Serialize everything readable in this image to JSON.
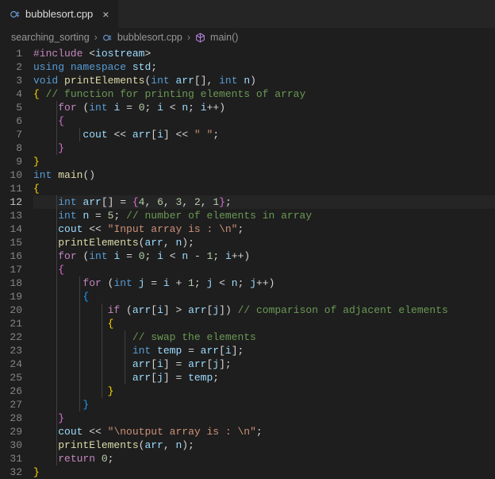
{
  "tab": {
    "filename": "bubblesort.cpp"
  },
  "breadcrumb": {
    "folder": "searching_sorting",
    "file": "bubblesort.cpp",
    "symbol": "main()"
  },
  "editor": {
    "current_line": 12,
    "lines": [
      {
        "n": 1,
        "tokens": [
          [
            "pp",
            "#include"
          ],
          [
            "op",
            " "
          ],
          [
            "punc",
            "<"
          ],
          [
            "id",
            "iostream"
          ],
          [
            "punc",
            ">"
          ]
        ]
      },
      {
        "n": 2,
        "tokens": [
          [
            "kw",
            "using"
          ],
          [
            "op",
            " "
          ],
          [
            "kw",
            "namespace"
          ],
          [
            "op",
            " "
          ],
          [
            "id",
            "std"
          ],
          [
            "punc",
            ";"
          ]
        ]
      },
      {
        "n": 3,
        "tokens": [
          [
            "kw",
            "void"
          ],
          [
            "op",
            " "
          ],
          [
            "func",
            "printElements"
          ],
          [
            "punc",
            "("
          ],
          [
            "kw",
            "int"
          ],
          [
            "op",
            " "
          ],
          [
            "id",
            "arr"
          ],
          [
            "punc",
            "[]"
          ],
          [
            "punc",
            ","
          ],
          [
            "op",
            " "
          ],
          [
            "kw",
            "int"
          ],
          [
            "op",
            " "
          ],
          [
            "id",
            "n"
          ],
          [
            "punc",
            ")"
          ]
        ]
      },
      {
        "n": 4,
        "tokens": [
          [
            "brak",
            "{"
          ],
          [
            "op",
            " "
          ],
          [
            "cmt",
            "// function for printing elements of array"
          ]
        ]
      },
      {
        "n": 5,
        "indent": 1,
        "tokens": [
          [
            "pp",
            "for"
          ],
          [
            "op",
            " "
          ],
          [
            "punc",
            "("
          ],
          [
            "kw",
            "int"
          ],
          [
            "op",
            " "
          ],
          [
            "id",
            "i"
          ],
          [
            "op",
            " = "
          ],
          [
            "num",
            "0"
          ],
          [
            "punc",
            ";"
          ],
          [
            "op",
            " "
          ],
          [
            "id",
            "i"
          ],
          [
            "op",
            " < "
          ],
          [
            "id",
            "n"
          ],
          [
            "punc",
            ";"
          ],
          [
            "op",
            " "
          ],
          [
            "id",
            "i"
          ],
          [
            "op",
            "++"
          ],
          [
            "punc",
            ")"
          ]
        ]
      },
      {
        "n": 6,
        "indent": 1,
        "tokens": [
          [
            "brak2",
            "{"
          ]
        ]
      },
      {
        "n": 7,
        "indent": 2,
        "tokens": [
          [
            "id",
            "cout"
          ],
          [
            "op",
            " << "
          ],
          [
            "id",
            "arr"
          ],
          [
            "punc",
            "["
          ],
          [
            "id",
            "i"
          ],
          [
            "punc",
            "]"
          ],
          [
            "op",
            " << "
          ],
          [
            "str",
            "\" \""
          ],
          [
            "punc",
            ";"
          ]
        ]
      },
      {
        "n": 8,
        "indent": 1,
        "tokens": [
          [
            "brak2",
            "}"
          ]
        ]
      },
      {
        "n": 9,
        "tokens": [
          [
            "brak",
            "}"
          ]
        ]
      },
      {
        "n": 10,
        "tokens": [
          [
            "kw",
            "int"
          ],
          [
            "op",
            " "
          ],
          [
            "func",
            "main"
          ],
          [
            "punc",
            "()"
          ]
        ]
      },
      {
        "n": 11,
        "tokens": [
          [
            "brak",
            "{"
          ]
        ]
      },
      {
        "n": 12,
        "indent": 1,
        "tokens": [
          [
            "kw",
            "int"
          ],
          [
            "op",
            " "
          ],
          [
            "id",
            "arr"
          ],
          [
            "punc",
            "[]"
          ],
          [
            "op",
            " = "
          ],
          [
            "brak2",
            "{"
          ],
          [
            "num",
            "4"
          ],
          [
            "punc",
            ", "
          ],
          [
            "num",
            "6"
          ],
          [
            "punc",
            ", "
          ],
          [
            "num",
            "3"
          ],
          [
            "punc",
            ", "
          ],
          [
            "num",
            "2"
          ],
          [
            "punc",
            ", "
          ],
          [
            "num",
            "1"
          ],
          [
            "brak2",
            "}"
          ],
          [
            "punc",
            ";"
          ]
        ]
      },
      {
        "n": 13,
        "indent": 1,
        "tokens": [
          [
            "kw",
            "int"
          ],
          [
            "op",
            " "
          ],
          [
            "id",
            "n"
          ],
          [
            "op",
            " = "
          ],
          [
            "num",
            "5"
          ],
          [
            "punc",
            ";"
          ],
          [
            "op",
            " "
          ],
          [
            "cmt",
            "// number of elements in array"
          ]
        ]
      },
      {
        "n": 14,
        "indent": 1,
        "tokens": [
          [
            "id",
            "cout"
          ],
          [
            "op",
            " << "
          ],
          [
            "str",
            "\"Input array is : \\n\""
          ],
          [
            "punc",
            ";"
          ]
        ]
      },
      {
        "n": 15,
        "indent": 1,
        "tokens": [
          [
            "func",
            "printElements"
          ],
          [
            "punc",
            "("
          ],
          [
            "id",
            "arr"
          ],
          [
            "punc",
            ", "
          ],
          [
            "id",
            "n"
          ],
          [
            "punc",
            ")"
          ],
          [
            "punc",
            ";"
          ]
        ]
      },
      {
        "n": 16,
        "indent": 1,
        "tokens": [
          [
            "pp",
            "for"
          ],
          [
            "op",
            " "
          ],
          [
            "punc",
            "("
          ],
          [
            "kw",
            "int"
          ],
          [
            "op",
            " "
          ],
          [
            "id",
            "i"
          ],
          [
            "op",
            " = "
          ],
          [
            "num",
            "0"
          ],
          [
            "punc",
            ";"
          ],
          [
            "op",
            " "
          ],
          [
            "id",
            "i"
          ],
          [
            "op",
            " < "
          ],
          [
            "id",
            "n"
          ],
          [
            "op",
            " - "
          ],
          [
            "num",
            "1"
          ],
          [
            "punc",
            ";"
          ],
          [
            "op",
            " "
          ],
          [
            "id",
            "i"
          ],
          [
            "op",
            "++"
          ],
          [
            "punc",
            ")"
          ]
        ]
      },
      {
        "n": 17,
        "indent": 1,
        "tokens": [
          [
            "brak2",
            "{"
          ]
        ]
      },
      {
        "n": 18,
        "indent": 2,
        "tokens": [
          [
            "pp",
            "for"
          ],
          [
            "op",
            " "
          ],
          [
            "punc",
            "("
          ],
          [
            "kw",
            "int"
          ],
          [
            "op",
            " "
          ],
          [
            "id",
            "j"
          ],
          [
            "op",
            " = "
          ],
          [
            "id",
            "i"
          ],
          [
            "op",
            " + "
          ],
          [
            "num",
            "1"
          ],
          [
            "punc",
            ";"
          ],
          [
            "op",
            " "
          ],
          [
            "id",
            "j"
          ],
          [
            "op",
            " < "
          ],
          [
            "id",
            "n"
          ],
          [
            "punc",
            ";"
          ],
          [
            "op",
            " "
          ],
          [
            "id",
            "j"
          ],
          [
            "op",
            "++"
          ],
          [
            "punc",
            ")"
          ]
        ]
      },
      {
        "n": 19,
        "indent": 2,
        "tokens": [
          [
            "brak3",
            "{"
          ]
        ]
      },
      {
        "n": 20,
        "indent": 3,
        "tokens": [
          [
            "pp",
            "if"
          ],
          [
            "op",
            " "
          ],
          [
            "punc",
            "("
          ],
          [
            "id",
            "arr"
          ],
          [
            "punc",
            "["
          ],
          [
            "id",
            "i"
          ],
          [
            "punc",
            "]"
          ],
          [
            "op",
            " > "
          ],
          [
            "id",
            "arr"
          ],
          [
            "punc",
            "["
          ],
          [
            "id",
            "j"
          ],
          [
            "punc",
            "]"
          ],
          [
            "punc",
            ")"
          ],
          [
            "op",
            " "
          ],
          [
            "cmt",
            "// comparison of adjacent elements"
          ]
        ]
      },
      {
        "n": 21,
        "indent": 3,
        "tokens": [
          [
            "brak",
            "{"
          ]
        ]
      },
      {
        "n": 22,
        "indent": 4,
        "tokens": [
          [
            "cmt",
            "// swap the elements"
          ]
        ]
      },
      {
        "n": 23,
        "indent": 4,
        "tokens": [
          [
            "kw",
            "int"
          ],
          [
            "op",
            " "
          ],
          [
            "id",
            "temp"
          ],
          [
            "op",
            " = "
          ],
          [
            "id",
            "arr"
          ],
          [
            "punc",
            "["
          ],
          [
            "id",
            "i"
          ],
          [
            "punc",
            "]"
          ],
          [
            "punc",
            ";"
          ]
        ]
      },
      {
        "n": 24,
        "indent": 4,
        "tokens": [
          [
            "id",
            "arr"
          ],
          [
            "punc",
            "["
          ],
          [
            "id",
            "i"
          ],
          [
            "punc",
            "]"
          ],
          [
            "op",
            " = "
          ],
          [
            "id",
            "arr"
          ],
          [
            "punc",
            "["
          ],
          [
            "id",
            "j"
          ],
          [
            "punc",
            "]"
          ],
          [
            "punc",
            ";"
          ]
        ]
      },
      {
        "n": 25,
        "indent": 4,
        "tokens": [
          [
            "id",
            "arr"
          ],
          [
            "punc",
            "["
          ],
          [
            "id",
            "j"
          ],
          [
            "punc",
            "]"
          ],
          [
            "op",
            " = "
          ],
          [
            "id",
            "temp"
          ],
          [
            "punc",
            ";"
          ]
        ]
      },
      {
        "n": 26,
        "indent": 3,
        "tokens": [
          [
            "brak",
            "}"
          ]
        ]
      },
      {
        "n": 27,
        "indent": 2,
        "tokens": [
          [
            "brak3",
            "}"
          ]
        ]
      },
      {
        "n": 28,
        "indent": 1,
        "tokens": [
          [
            "brak2",
            "}"
          ]
        ]
      },
      {
        "n": 29,
        "indent": 1,
        "tokens": [
          [
            "id",
            "cout"
          ],
          [
            "op",
            " << "
          ],
          [
            "str",
            "\"\\noutput array is : \\n\""
          ],
          [
            "punc",
            ";"
          ]
        ]
      },
      {
        "n": 30,
        "indent": 1,
        "tokens": [
          [
            "func",
            "printElements"
          ],
          [
            "punc",
            "("
          ],
          [
            "id",
            "arr"
          ],
          [
            "punc",
            ", "
          ],
          [
            "id",
            "n"
          ],
          [
            "punc",
            ")"
          ],
          [
            "punc",
            ";"
          ]
        ]
      },
      {
        "n": 31,
        "indent": 1,
        "tokens": [
          [
            "pp",
            "return"
          ],
          [
            "op",
            " "
          ],
          [
            "num",
            "0"
          ],
          [
            "punc",
            ";"
          ]
        ]
      },
      {
        "n": 32,
        "tokens": [
          [
            "brak",
            "}"
          ]
        ]
      }
    ]
  }
}
